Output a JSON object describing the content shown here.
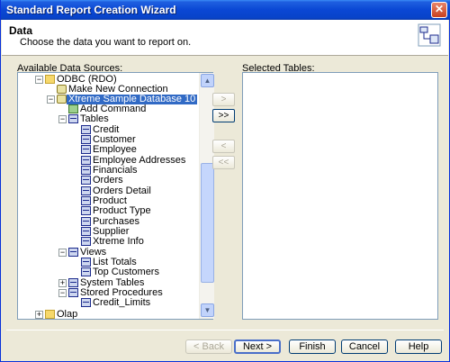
{
  "window": {
    "title": "Standard Report Creation Wizard",
    "close_label": "✕"
  },
  "header": {
    "title": "Data",
    "subtitle": "Choose the data you want to report on."
  },
  "left": {
    "label": "Available Data Sources:"
  },
  "right": {
    "label": "Selected Tables:"
  },
  "tree": {
    "root": "ODBC (RDO)",
    "make_new_connection": "Make New Connection",
    "database": "Xtreme Sample Database 10",
    "add_command": "Add Command",
    "tables_label": "Tables",
    "tables": [
      "Credit",
      "Customer",
      "Employee",
      "Employee Addresses",
      "Financials",
      "Orders",
      "Orders Detail",
      "Product",
      "Product Type",
      "Purchases",
      "Supplier",
      "Xtreme Info"
    ],
    "views_label": "Views",
    "views": [
      "List Totals",
      "Top Customers"
    ],
    "system_tables": "System Tables",
    "stored_procedures": "Stored Procedures",
    "procedures": [
      "Credit_Limits"
    ],
    "olap": "Olap"
  },
  "move_buttons": {
    "add_one": ">",
    "add_all": ">>",
    "remove_one": "<",
    "remove_all": "<<"
  },
  "buttons": {
    "back": "< Back",
    "next": "Next >",
    "finish": "Finish",
    "cancel": "Cancel",
    "help": "Help"
  }
}
